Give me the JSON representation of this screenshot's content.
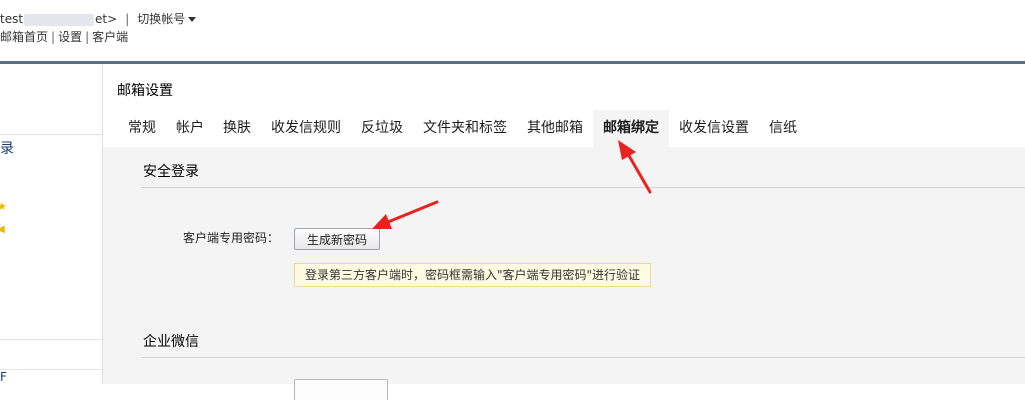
{
  "header": {
    "account_prefix": "test",
    "account_suffix": "et>",
    "separator": "|",
    "switch_account": "切换帐号",
    "links": [
      "邮箱首页",
      "设置",
      "客户端"
    ],
    "link_separator": "|"
  },
  "sidebar": {
    "login_label": "录",
    "bottom_label": "F"
  },
  "main": {
    "title": "邮箱设置",
    "tabs": [
      {
        "label": "常规",
        "active": false
      },
      {
        "label": "帐户",
        "active": false
      },
      {
        "label": "换肤",
        "active": false
      },
      {
        "label": "收发信规则",
        "active": false
      },
      {
        "label": "反垃圾",
        "active": false
      },
      {
        "label": "文件夹和标签",
        "active": false
      },
      {
        "label": "其他邮箱",
        "active": false
      },
      {
        "label": "邮箱绑定",
        "active": true
      },
      {
        "label": "收发信设置",
        "active": false
      },
      {
        "label": "信纸",
        "active": false
      }
    ],
    "secure_login": {
      "title": "安全登录",
      "password_label": "客户端专用密码：",
      "generate_button": "生成新密码",
      "hint": "登录第三方客户端时，密码框需输入\"客户端专用密码\"进行验证"
    },
    "wechat": {
      "title": "企业微信"
    }
  },
  "colors": {
    "top_bar": "#5b6f87",
    "annotation_arrow": "#e8231e",
    "hint_background": "#fffbe2"
  }
}
